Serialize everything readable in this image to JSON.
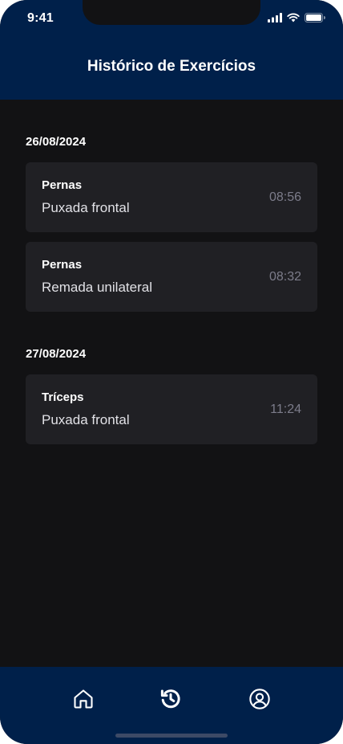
{
  "status_bar": {
    "time": "9:41",
    "icons": [
      "signal-icon",
      "wifi-icon",
      "battery-icon"
    ]
  },
  "header": {
    "title": "Histórico de Exercícios"
  },
  "sections": [
    {
      "date": "26/08/2024",
      "items": [
        {
          "group": "Pernas",
          "exercise": "Puxada frontal",
          "time": "08:56"
        },
        {
          "group": "Pernas",
          "exercise": "Remada unilateral",
          "time": "08:32"
        }
      ]
    },
    {
      "date": "27/08/2024",
      "items": [
        {
          "group": "Tríceps",
          "exercise": "Puxada frontal",
          "time": "11:24"
        }
      ]
    }
  ],
  "nav": {
    "items": [
      "home-icon",
      "history-icon",
      "profile-icon"
    ],
    "active": "history-icon"
  },
  "colors": {
    "header_bg": "#00204A",
    "background": "#121214",
    "card_bg": "#202024",
    "time_text": "#7C7C8A"
  }
}
